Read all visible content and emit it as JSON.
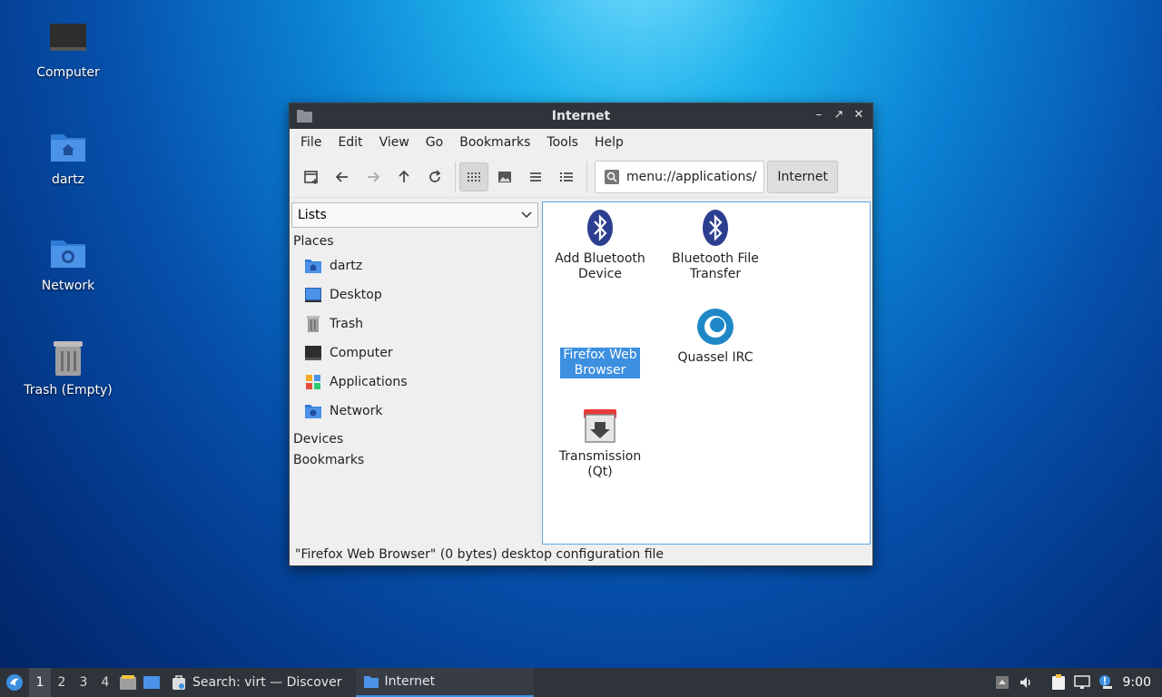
{
  "desktop": {
    "icons": [
      {
        "label": "Computer",
        "icon": "computer-icon"
      },
      {
        "label": "dartz",
        "icon": "home-folder-icon"
      },
      {
        "label": "Network",
        "icon": "network-folder-icon"
      },
      {
        "label": "Trash (Empty)",
        "icon": "trash-icon"
      }
    ]
  },
  "window": {
    "title": "Internet",
    "menu": [
      "File",
      "Edit",
      "View",
      "Go",
      "Bookmarks",
      "Tools",
      "Help"
    ],
    "address": "menu://applications/",
    "breadcrumb": "Internet",
    "sidebar": {
      "mode": "Lists",
      "sections": {
        "places": "Places",
        "devices": "Devices",
        "bookmarks": "Bookmarks"
      },
      "places": [
        "dartz",
        "Desktop",
        "Trash",
        "Computer",
        "Applications",
        "Network"
      ]
    },
    "items": [
      {
        "label": "Add Bluetooth Device",
        "icon": "bluetooth-icon"
      },
      {
        "label": "Bluetooth File Transfer",
        "icon": "bluetooth-icon"
      },
      {
        "label": "Firefox Web Browser",
        "icon": "firefox-icon",
        "selected": true
      },
      {
        "label": "Quassel IRC",
        "icon": "quassel-icon"
      },
      {
        "label": "Transmission (Qt)",
        "icon": "transmission-icon"
      }
    ],
    "status": "\"Firefox Web Browser\" (0 bytes) desktop configuration file"
  },
  "taskbar": {
    "workspaces": [
      "1",
      "2",
      "3",
      "4"
    ],
    "active_workspace": "1",
    "tasks": [
      {
        "label": "Search: virt — Discover"
      },
      {
        "label": "Internet"
      }
    ],
    "clock": "9:00"
  },
  "colors": {
    "accent": "#3d8fe0",
    "titlebar": "#2f343b",
    "bluetooth": "#2c3e8f"
  }
}
